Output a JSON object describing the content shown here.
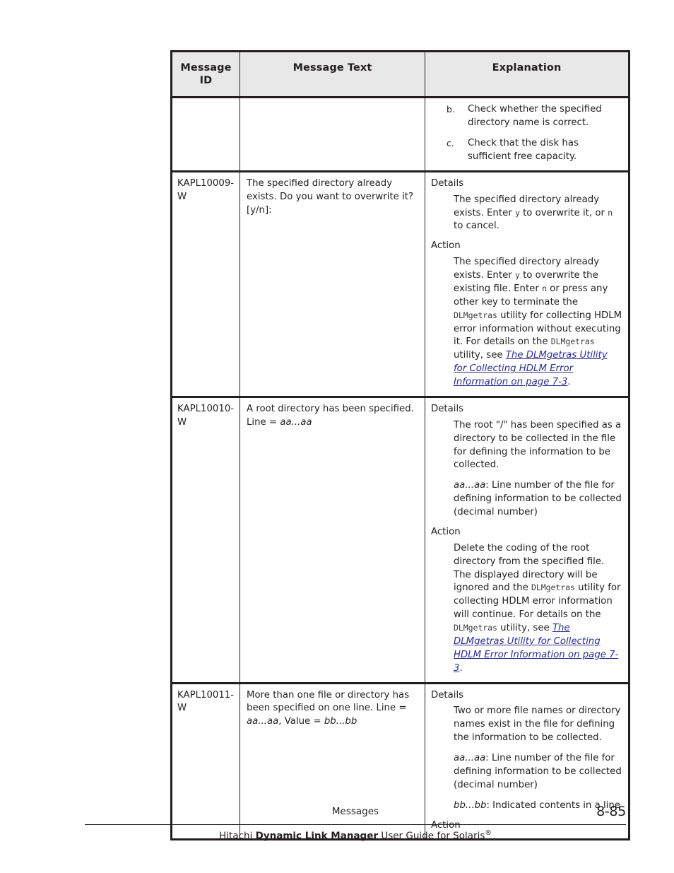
{
  "table": {
    "headers": {
      "id": "Message\nID",
      "id_line1": "Message",
      "id_line2": "ID",
      "text": "Message Text",
      "explanation": "Explanation"
    },
    "rows": [
      {
        "id": "",
        "message_text": "",
        "explanation_items": [
          {
            "marker": "b.",
            "text": "Check whether the specified directory name is correct."
          },
          {
            "marker": "c.",
            "text": "Check that the disk has sufficient free capacity."
          }
        ]
      },
      {
        "id": "KAPL10009-W",
        "message_text": "The specified directory already exists. Do you want to overwrite it? [y/n]:",
        "details_label": "Details",
        "details_text_a": "The specified directory already exists. Enter ",
        "details_code_1": "y",
        "details_text_b": " to overwrite it, or ",
        "details_code_2": "n",
        "details_text_c": " to cancel.",
        "action_label": "Action",
        "action_text_a": "The specified directory already exists. Enter ",
        "action_code_1": "y",
        "action_text_b": " to overwrite the existing file. Enter ",
        "action_code_2": "n",
        "action_text_c": " or press any other key to terminate the ",
        "action_code_3": "DLMgetras",
        "action_text_d": " utility for collecting HDLM error information without executing it. For details on the ",
        "action_code_4": "DLMgetras",
        "action_text_e": " utility, see ",
        "action_link": "The DLMgetras Utility for Collecting HDLM Error Information on page 7-3",
        "action_text_f": "."
      },
      {
        "id": "KAPL10010-W",
        "message_text_a": "A root directory has been specified. Line = ",
        "message_text_var": "aa...aa",
        "details_label": "Details",
        "details_p1": "The root \"/\" has been specified as a directory to be collected in the file for defining the information to be collected.",
        "details_p2_var": "aa...aa",
        "details_p2_text": ": Line number of the file for defining information to be collected (decimal number)",
        "action_label": "Action",
        "action_text_a": "Delete the coding of the root directory from the specified file. The displayed directory will be ignored and the ",
        "action_code_1": "DLMgetras",
        "action_text_b": " utility for collecting HDLM error information will continue. For details on the ",
        "action_code_2": "DLMgetras",
        "action_text_c": " utility, see ",
        "action_link": "The DLMgetras Utility for Collecting HDLM Error Information on page 7-3",
        "action_text_d": "."
      },
      {
        "id": "KAPL10011-W",
        "message_text_a": "More than one file or directory has been specified on one line. Line = ",
        "message_text_var1": "aa...aa",
        "message_text_b": ", Value = ",
        "message_text_var2": "bb...bb",
        "details_label": "Details",
        "details_p1": "Two or more file names or directory names exist in the file for defining the information to be collected.",
        "details_p2_var": "aa...aa",
        "details_p2_text": ": Line number of the file for defining information to be collected (decimal number)",
        "details_p3_var": "bb...bb",
        "details_p3_text": ": Indicated contents in a line",
        "action_label": "Action"
      }
    ]
  },
  "footer": {
    "section": "Messages",
    "page_number": "8-85",
    "guide_prefix": "Hitachi ",
    "guide_bold": "Dynamic Link Manager",
    "guide_suffix": " User Guide for Solaris",
    "guide_superscript": "®"
  },
  "colors": {
    "link": "#2c2f8f",
    "header_bg": "#e8e8e8",
    "ink": "#231f20"
  }
}
